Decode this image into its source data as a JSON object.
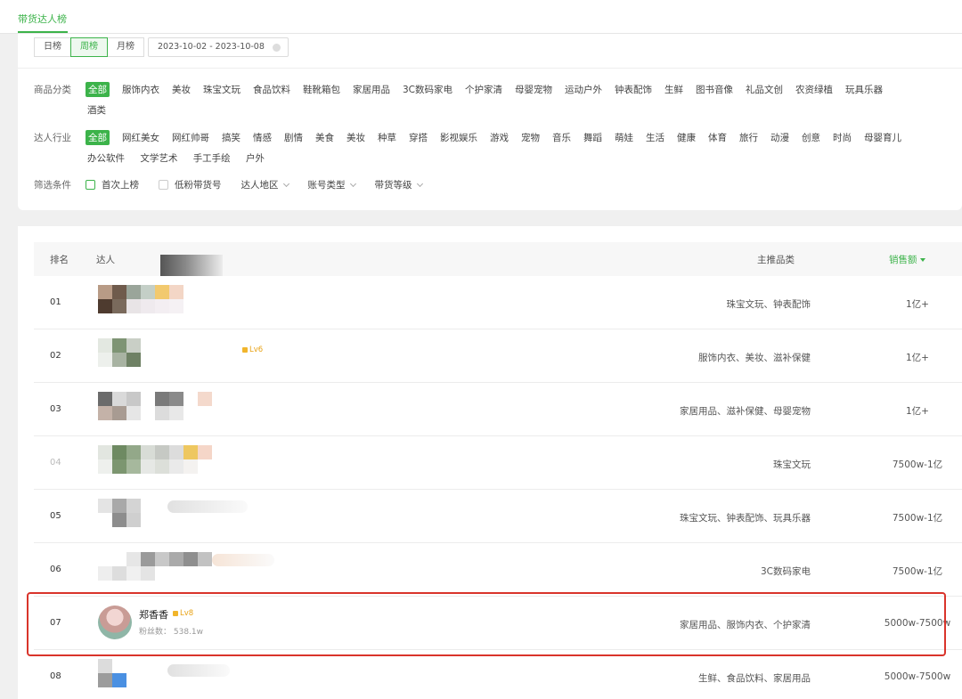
{
  "top_tab": {
    "label": "带货达人榜"
  },
  "period": {
    "options": [
      "日榜",
      "周榜",
      "月榜"
    ],
    "active": "周榜",
    "date_range": "2023-10-02 - 2023-10-08"
  },
  "product_category": {
    "label": "商品分类",
    "items": [
      "全部",
      "服饰内衣",
      "美妆",
      "珠宝文玩",
      "食品饮料",
      "鞋靴箱包",
      "家居用品",
      "3C数码家电",
      "个护家清",
      "母婴宠物",
      "运动户外",
      "钟表配饰",
      "生鲜",
      "图书音像",
      "礼品文创",
      "农资绿植",
      "玩具乐器"
    ],
    "overflow": [
      "酒类"
    ]
  },
  "influencer_industry": {
    "label": "达人行业",
    "items": [
      "全部",
      "网红美女",
      "网红帅哥",
      "搞笑",
      "情感",
      "剧情",
      "美食",
      "美妆",
      "种草",
      "穿搭",
      "影视娱乐",
      "游戏",
      "宠物",
      "音乐",
      "舞蹈",
      "萌娃",
      "生活",
      "健康",
      "体育",
      "旅行",
      "动漫",
      "创意",
      "时尚",
      "母婴育儿"
    ],
    "overflow": [
      "办公软件",
      "文学艺术",
      "手工手绘",
      "户外"
    ]
  },
  "filter_conditions": {
    "label": "筛选条件",
    "checkboxes": [
      "首次上榜",
      "低粉带货号"
    ],
    "dropdowns": [
      "达人地区",
      "账号类型",
      "带货等级"
    ]
  },
  "table": {
    "headers": {
      "rank": "排名",
      "influencer": "达人",
      "category": "主推品类",
      "sales": "销售额"
    },
    "rows": [
      {
        "rank": "01",
        "category": "珠宝文玩、钟表配饰",
        "sales": "1亿+"
      },
      {
        "rank": "02",
        "level": "Lv6",
        "category": "服饰内衣、美妆、滋补保健",
        "sales": "1亿+"
      },
      {
        "rank": "03",
        "category": "家居用品、滋补保健、母婴宠物",
        "sales": "1亿+"
      },
      {
        "rank": "04",
        "category": "珠宝文玩",
        "sales": "7500w-1亿"
      },
      {
        "rank": "05",
        "category": "珠宝文玩、钟表配饰、玩具乐器",
        "sales": "7500w-1亿"
      },
      {
        "rank": "06",
        "category": "3C数码家电",
        "sales": "7500w-1亿"
      },
      {
        "rank": "07",
        "name": "郑香香",
        "level": "Lv8",
        "fans": "粉丝数： 538.1w",
        "category": "家居用品、服饰内衣、个护家清",
        "sales": "5000w-7500w"
      },
      {
        "rank": "08",
        "category": "生鲜、食品饮料、家居用品",
        "sales": "5000w-7500w"
      }
    ]
  },
  "colors": {
    "accent": "#3cb34a",
    "highlight": "#d9342b",
    "level": "#e8a317"
  }
}
